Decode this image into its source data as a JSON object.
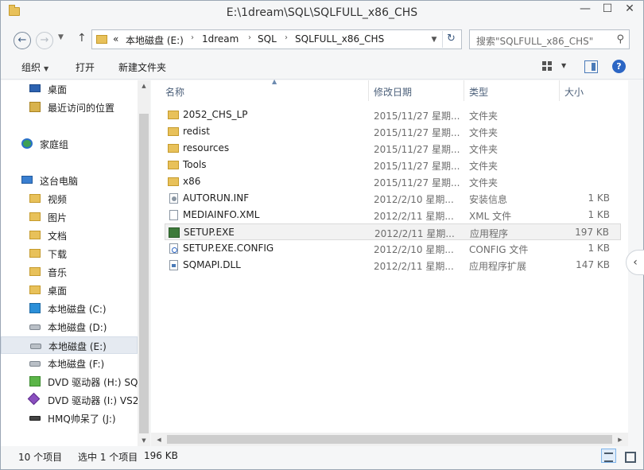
{
  "window": {
    "title": "E:\\1dream\\SQL\\SQLFULL_x86_CHS",
    "minimize": "—",
    "maximize": "☐",
    "close": "✕"
  },
  "address": {
    "prefix": "«",
    "crumbs": [
      "本地磁盘 (E:)",
      "1dream",
      "SQL",
      "SQLFULL_x86_CHS"
    ],
    "separator": "›",
    "search_placeholder": "搜索\"SQLFULL_x86_CHS\""
  },
  "toolbar": {
    "organize": "组织",
    "open": "打开",
    "new_folder": "新建文件夹"
  },
  "nav": {
    "items": [
      {
        "label": "桌面",
        "icon": "desktop-icon"
      },
      {
        "label": "最近访问的位置",
        "icon": "recent-places-icon"
      },
      {
        "label": "家庭组",
        "icon": "homegroup-icon"
      },
      {
        "label": "这台电脑",
        "icon": "this-pc-icon"
      },
      {
        "label": "视频",
        "icon": "videos-folder-icon"
      },
      {
        "label": "图片",
        "icon": "pictures-folder-icon"
      },
      {
        "label": "文档",
        "icon": "documents-folder-icon"
      },
      {
        "label": "下载",
        "icon": "downloads-folder-icon"
      },
      {
        "label": "音乐",
        "icon": "music-folder-icon"
      },
      {
        "label": "桌面",
        "icon": "desktop-folder-icon"
      },
      {
        "label": "本地磁盘 (C:)",
        "icon": "system-drive-icon"
      },
      {
        "label": "本地磁盘 (D:)",
        "icon": "drive-icon"
      },
      {
        "label": "本地磁盘 (E:)",
        "icon": "drive-icon"
      },
      {
        "label": "本地磁盘 (F:)",
        "icon": "drive-icon"
      },
      {
        "label": "DVD 驱动器 (H:) SQ",
        "icon": "dvd-sql-icon"
      },
      {
        "label": "DVD 驱动器 (I:) VS2",
        "icon": "dvd-vs-icon"
      },
      {
        "label": "HMQ帅呆了 (J:)",
        "icon": "usb-drive-icon"
      }
    ],
    "selected_index": 12
  },
  "columns": {
    "name": "名称",
    "date": "修改日期",
    "type": "类型",
    "size": "大小"
  },
  "files": [
    {
      "name": "2052_CHS_LP",
      "date": "2015/11/27 星期...",
      "type": "文件夹",
      "size": "",
      "kind": "folder"
    },
    {
      "name": "redist",
      "date": "2015/11/27 星期...",
      "type": "文件夹",
      "size": "",
      "kind": "folder"
    },
    {
      "name": "resources",
      "date": "2015/11/27 星期...",
      "type": "文件夹",
      "size": "",
      "kind": "folder"
    },
    {
      "name": "Tools",
      "date": "2015/11/27 星期...",
      "type": "文件夹",
      "size": "",
      "kind": "folder"
    },
    {
      "name": "x86",
      "date": "2015/11/27 星期...",
      "type": "文件夹",
      "size": "",
      "kind": "folder"
    },
    {
      "name": "AUTORUN.INF",
      "date": "2012/2/10 星期...",
      "type": "安装信息",
      "size": "1 KB",
      "kind": "inf"
    },
    {
      "name": "MEDIAINFO.XML",
      "date": "2012/2/11 星期...",
      "type": "XML 文件",
      "size": "1 KB",
      "kind": "doc"
    },
    {
      "name": "SETUP.EXE",
      "date": "2012/2/11 星期...",
      "type": "应用程序",
      "size": "197 KB",
      "kind": "exe"
    },
    {
      "name": "SETUP.EXE.CONFIG",
      "date": "2012/2/10 星期...",
      "type": "CONFIG 文件",
      "size": "1 KB",
      "kind": "cfg"
    },
    {
      "name": "SQMAPI.DLL",
      "date": "2012/2/11 星期...",
      "type": "应用程序扩展",
      "size": "147 KB",
      "kind": "dll"
    }
  ],
  "selected_file_index": 7,
  "status": {
    "count": "10 个项目",
    "selection": "选中 1 个项目",
    "size": "196 KB"
  },
  "colors": {
    "accent": "#2c66c4",
    "folder": "#e8c15a",
    "selection": "#e5eaf1"
  }
}
